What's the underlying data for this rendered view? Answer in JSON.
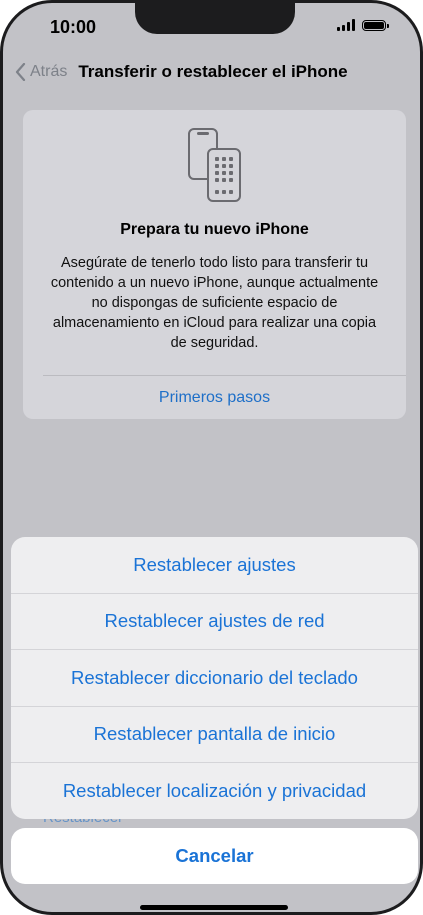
{
  "status_bar": {
    "time": "10:00"
  },
  "nav": {
    "back_label": "Atrás",
    "title": "Transferir o restablecer el iPhone"
  },
  "card": {
    "icon": "two-phones-icon",
    "heading": "Prepara tu nuevo iPhone",
    "body": "Asegúrate de tenerlo todo listo para transferir tu contenido a un nuevo iPhone, aunque actualmente no dispongas de suficiente espacio de almacenamiento en iCloud para realizar una copia de seguridad.",
    "link": "Primeros pasos"
  },
  "background_row": "Restablecer",
  "action_sheet": {
    "items": [
      "Restablecer ajustes",
      "Restablecer ajustes de red",
      "Restablecer diccionario del teclado",
      "Restablecer pantalla de inicio",
      "Restablecer localización y privacidad"
    ],
    "cancel_label": "Cancelar"
  },
  "colors": {
    "accent": "#1a73d6",
    "dim_background": "#c2c2c7"
  }
}
